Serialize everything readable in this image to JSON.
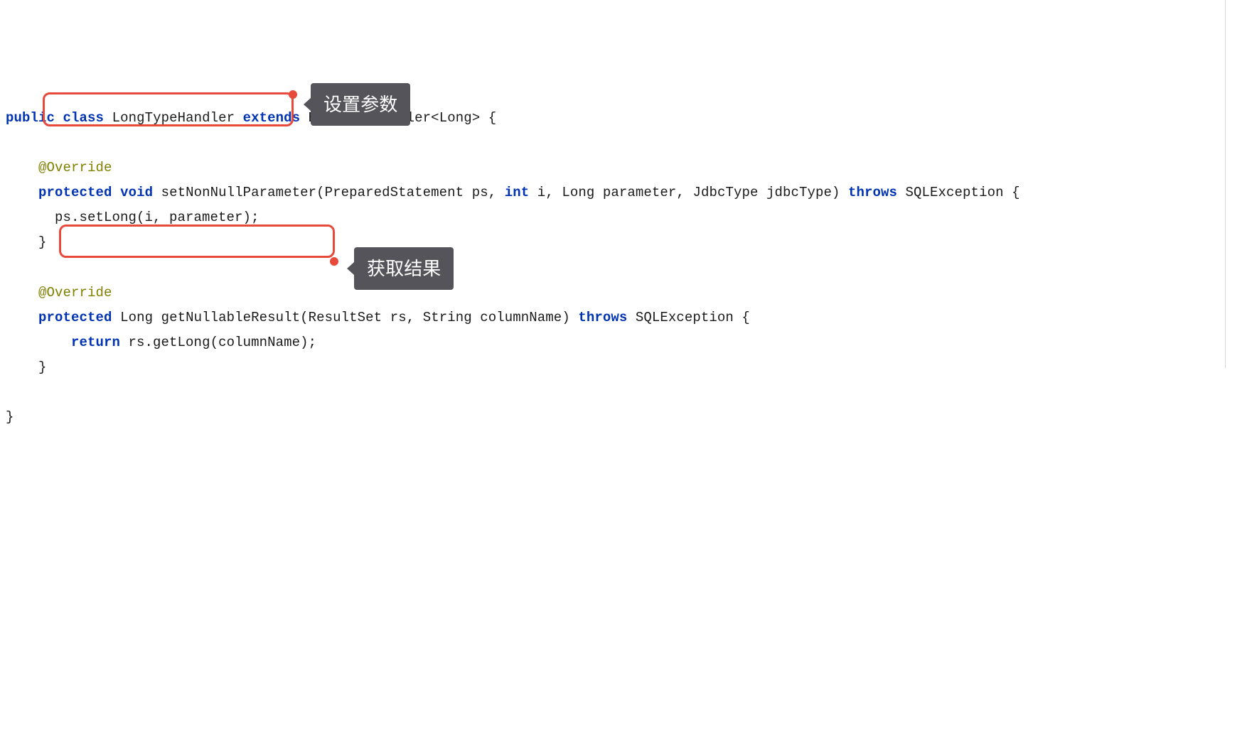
{
  "code": {
    "tokens": {
      "kw_public": "public",
      "kw_class": "class",
      "cls_name": "LongTypeHandler",
      "kw_extends": "extends",
      "base_cls": "BaseTypeHandler",
      "lt": "<",
      "type_Long": "Long",
      "gt": ">",
      "lbrace": "{",
      "rbrace": "}",
      "at_override": "@Override",
      "kw_protected": "protected",
      "kw_void": "void",
      "m1_name": "setNonNullParameter",
      "m1_open": "(",
      "m1_p1_type": "PreparedStatement",
      "m1_p1_name": "ps",
      "comma": ",",
      "kw_int": "int",
      "m1_p2_name": "i",
      "m1_p3_name": "parameter",
      "m1_p4_type": "JdbcType",
      "m1_p4_name": "jdbcType",
      "m1_close": ")",
      "kw_throws": "throws",
      "exc": "SQLException",
      "m1_body": "ps.setLong(i, parameter);",
      "m2_name": "getNullableResult",
      "m2_p1_type": "ResultSet",
      "m2_p1_name": "rs",
      "m2_p2_type": "String",
      "m2_p2_name": "columnName",
      "kw_return": "return",
      "m2_expr": "rs.getLong(columnName);"
    }
  },
  "annotations": {
    "callout1": "设置参数",
    "callout2": "获取结果"
  }
}
